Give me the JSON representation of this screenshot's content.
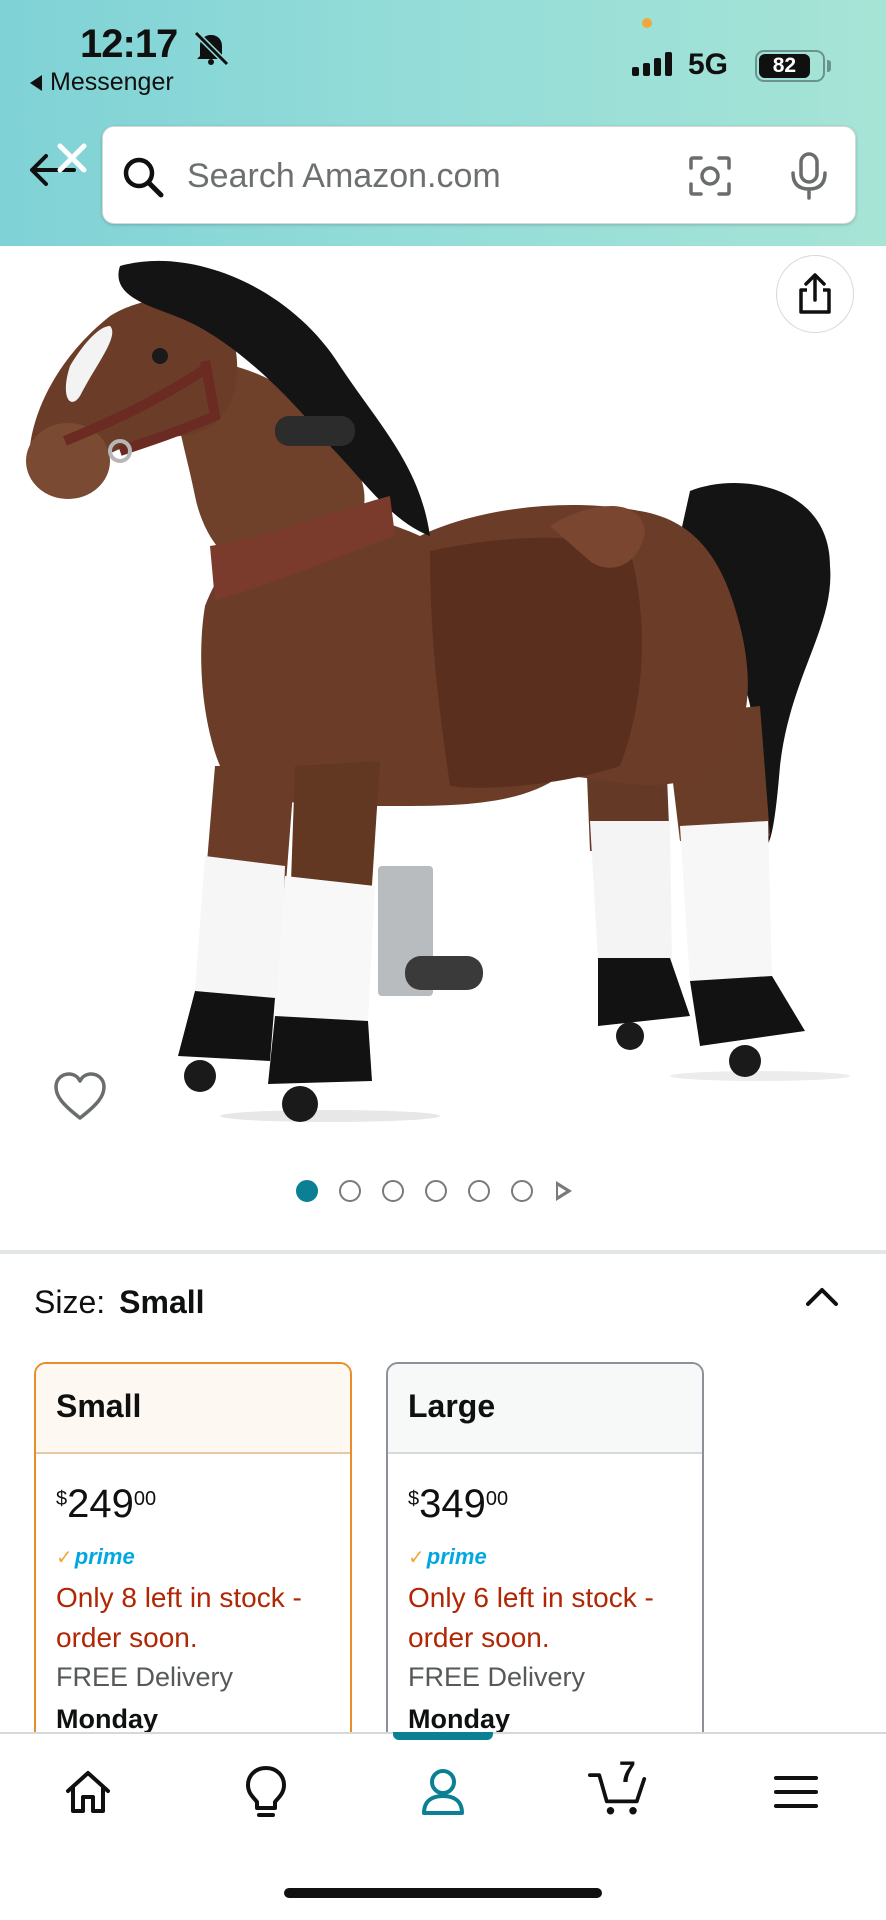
{
  "status_bar": {
    "time": "12:17",
    "back_app_label": "Messenger",
    "network": "5G",
    "battery": "82",
    "battery_level": 0.82
  },
  "search": {
    "placeholder": "Search Amazon.com",
    "value": ""
  },
  "gallery": {
    "image_count": 6,
    "active_index": 0
  },
  "size_selector": {
    "label": "Size:",
    "selected": "Small"
  },
  "options": [
    {
      "name": "Small",
      "price_symbol": "$",
      "price_whole": "249",
      "price_fraction": "00",
      "prime": "prime",
      "stock": "Only 8 left in stock - order soon.",
      "delivery": "FREE Delivery",
      "day": "Monday"
    },
    {
      "name": "Large",
      "price_symbol": "$",
      "price_whole": "349",
      "price_fraction": "00",
      "prime": "prime",
      "stock": "Only 6 left in stock - order soon.",
      "delivery": "FREE Delivery",
      "day": "Monday"
    }
  ],
  "nav": {
    "cart_count": "7",
    "items": [
      "home-icon",
      "lightbulb-icon",
      "account-icon",
      "cart-icon",
      "menu-icon"
    ],
    "active": "account"
  },
  "colors": {
    "header_gradient_start": "#7fd2d6",
    "header_gradient_end": "#a6e4d6",
    "accent_teal": "#0b7f93",
    "stock_red": "#b12704",
    "selected_border": "#e88d2a",
    "prime_blue": "#00a8e1"
  }
}
